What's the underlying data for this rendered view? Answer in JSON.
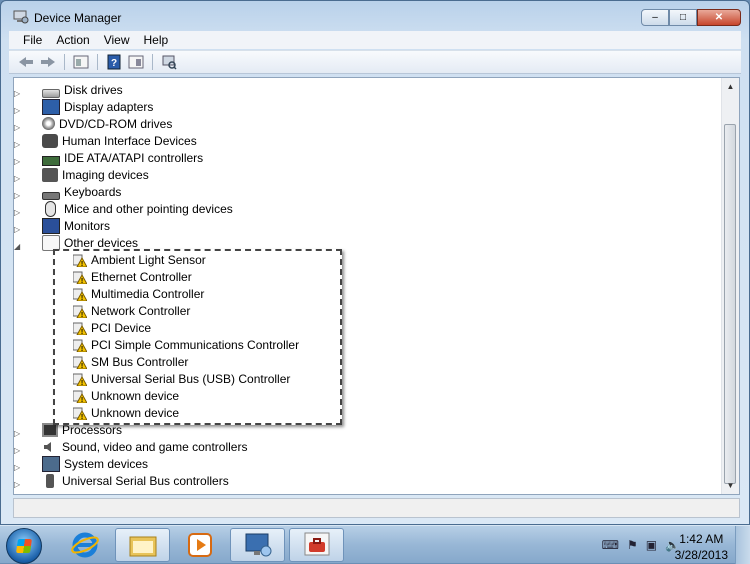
{
  "window": {
    "title": "Device Manager",
    "caption": {
      "minimize": "–",
      "maximize": "□",
      "close": "✕"
    }
  },
  "menu": [
    "File",
    "Action",
    "View",
    "Help"
  ],
  "toolbar": {
    "back_icon": "back-arrow-icon",
    "forward_icon": "forward-arrow-icon",
    "properties_icon": "properties-icon",
    "help_icon": "help-icon",
    "resources_icon": "resources-icon",
    "scan_icon": "scan-hardware-icon"
  },
  "tree": {
    "categories_top": [
      {
        "label": "Disk drives",
        "icon": "disk-drive-icon"
      },
      {
        "label": "Display adapters",
        "icon": "display-adapter-icon"
      },
      {
        "label": "DVD/CD-ROM drives",
        "icon": "dvd-drive-icon"
      },
      {
        "label": "Human Interface Devices",
        "icon": "hid-icon"
      },
      {
        "label": "IDE ATA/ATAPI controllers",
        "icon": "ide-controller-icon"
      },
      {
        "label": "Imaging devices",
        "icon": "camera-icon"
      },
      {
        "label": "Keyboards",
        "icon": "keyboard-icon"
      },
      {
        "label": "Mice and other pointing devices",
        "icon": "mouse-icon"
      },
      {
        "label": "Monitors",
        "icon": "monitor-icon"
      }
    ],
    "expanded": {
      "label": "Other devices",
      "icon": "unknown-device-icon",
      "children": [
        "Ambient Light Sensor",
        "Ethernet Controller",
        "Multimedia Controller",
        "Network Controller",
        "PCI Device",
        "PCI Simple Communications Controller",
        "SM Bus Controller",
        "Universal Serial Bus (USB) Controller",
        "Unknown device",
        "Unknown device"
      ]
    },
    "categories_bottom": [
      {
        "label": "Processors",
        "icon": "processor-icon"
      },
      {
        "label": "Sound, video and game controllers",
        "icon": "speaker-icon"
      },
      {
        "label": "System devices",
        "icon": "system-device-icon"
      },
      {
        "label": "Universal Serial Bus controllers",
        "icon": "usb-icon"
      }
    ]
  },
  "taskbar": {
    "clock_time": "1:42 AM",
    "clock_date": "3/28/2013",
    "pinned": [
      "internet-explorer-icon",
      "explorer-icon",
      "media-player-icon",
      "remote-desktop-icon",
      "toolbox-icon"
    ]
  }
}
